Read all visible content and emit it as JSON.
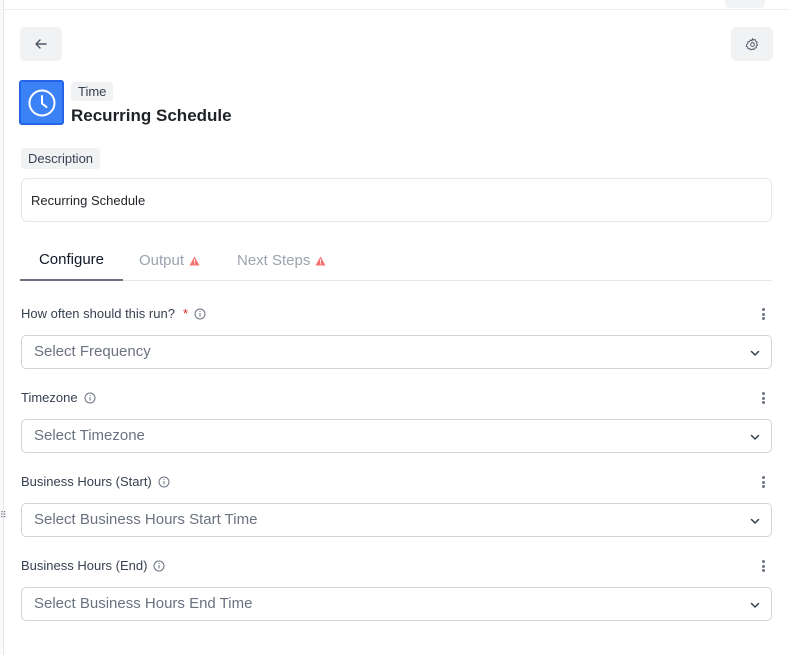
{
  "header": {
    "back_icon": "arrow-left-icon",
    "settings_icon": "gear-icon"
  },
  "app": {
    "icon": "clock-icon",
    "icon_color": "#3b82f6",
    "tag": "Time",
    "title": "Recurring Schedule"
  },
  "description": {
    "label": "Description",
    "value": "Recurring Schedule"
  },
  "tabs": [
    {
      "label": "Configure",
      "active": true,
      "warning": false
    },
    {
      "label": "Output",
      "active": false,
      "warning": true
    },
    {
      "label": "Next Steps",
      "active": false,
      "warning": true
    }
  ],
  "colors": {
    "warning": "#f87171",
    "required": "#dc2626",
    "accent": "#3b82f6"
  },
  "fields": [
    {
      "label": "How often should this run?",
      "required": true,
      "placeholder": "Select Frequency"
    },
    {
      "label": "Timezone",
      "required": false,
      "placeholder": "Select Timezone"
    },
    {
      "label": "Business Hours (Start)",
      "required": false,
      "placeholder": "Select Business Hours Start Time"
    },
    {
      "label": "Business Hours (End)",
      "required": false,
      "placeholder": "Select Business Hours End Time"
    }
  ],
  "required_marker": "*"
}
